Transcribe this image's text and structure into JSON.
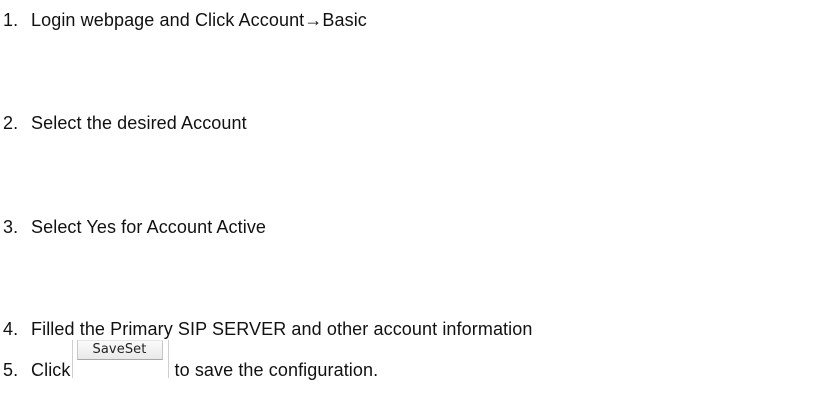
{
  "steps": [
    {
      "number": "1.",
      "text": "Login webpage and Click Account→Basic"
    },
    {
      "number": "2.",
      "text": "Select the desired Account"
    },
    {
      "number": "3.",
      "text": "Select Yes for Account Active"
    },
    {
      "number": "4.",
      "text": "Filled the Primary SIP SERVER and other account information"
    },
    {
      "number": "5.",
      "text_before": "Click",
      "button_label": "SaveSet",
      "text_after": "to save the configuration."
    }
  ]
}
